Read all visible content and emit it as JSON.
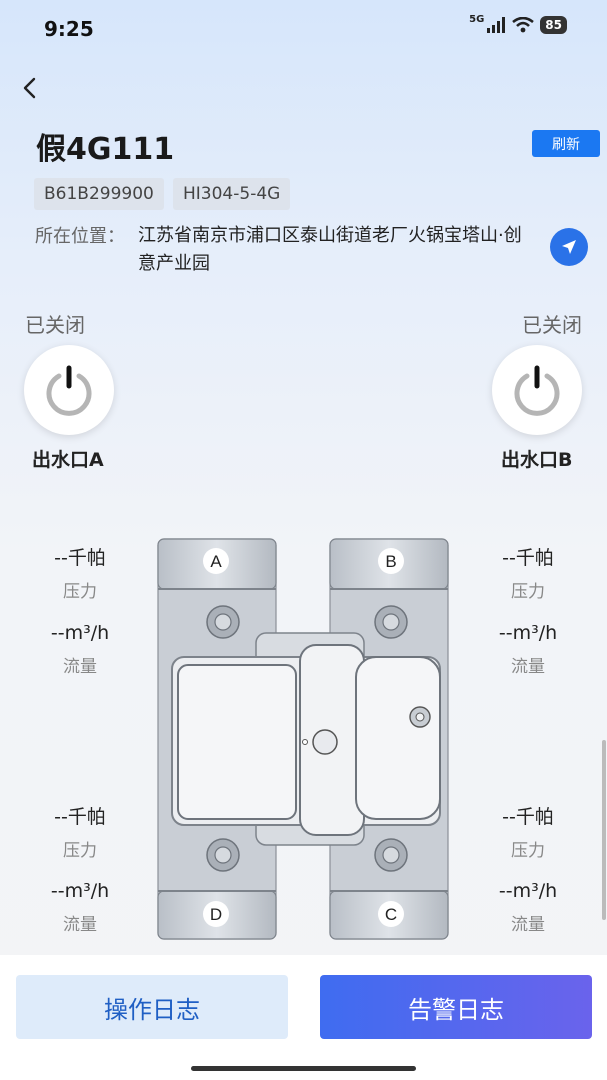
{
  "status_bar": {
    "time": "9:25",
    "network": "5G",
    "battery": "85"
  },
  "header": {
    "title": "假4G111",
    "refresh_label": "刷新"
  },
  "device_info": {
    "serial": "B61B299900",
    "model": "HI304-5-4G",
    "location_label": "所在位置：",
    "location_value": "江苏省南京市浦口区泰山街道老厂火锅宝塔山·创意产业园"
  },
  "outlets": {
    "a": {
      "status": "已关闭",
      "label": "出水口A",
      "port": "A"
    },
    "b": {
      "status": "已关闭",
      "label": "出水口B",
      "port": "B"
    },
    "c": {
      "port": "C"
    },
    "d": {
      "port": "D"
    }
  },
  "readings": {
    "top_left": {
      "pressure": "--千帕",
      "pressure_label": "压力",
      "flow": "--m³/h",
      "flow_label": "流量"
    },
    "top_right": {
      "pressure": "--千帕",
      "pressure_label": "压力",
      "flow": "--m³/h",
      "flow_label": "流量"
    },
    "bottom_left": {
      "pressure": "--千帕",
      "pressure_label": "压力",
      "flow": "--m³/h",
      "flow_label": "流量"
    },
    "bottom_right": {
      "pressure": "--千帕",
      "pressure_label": "压力",
      "flow": "--m³/h",
      "flow_label": "流量"
    }
  },
  "actions": {
    "operation_log": "操作日志",
    "alarm_log": "告警日志"
  },
  "colors": {
    "primary": "#1b78f2",
    "alarm_gradient_start": "#3f6cf0",
    "alarm_gradient_end": "#6a63ec",
    "oplog_bg": "#deebfa"
  }
}
